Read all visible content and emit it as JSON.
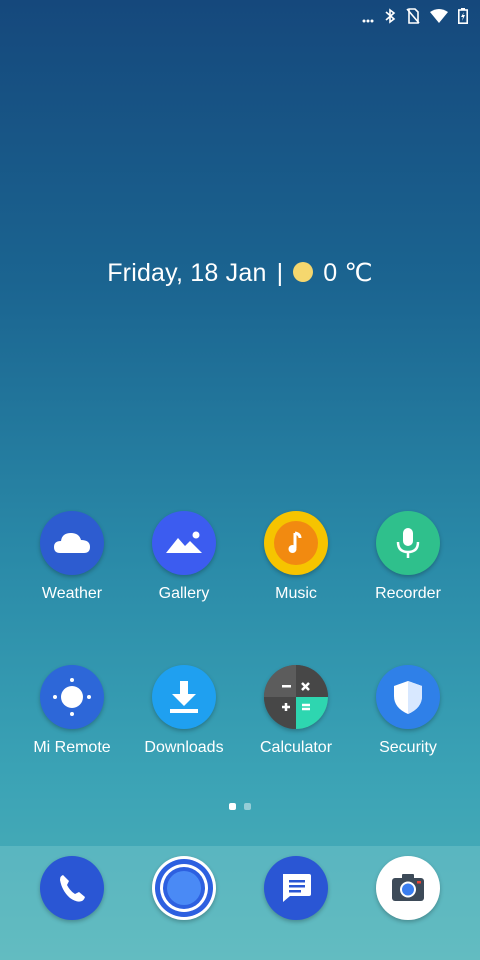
{
  "status_bar": {
    "icons": [
      "more-dots-icon",
      "bluetooth-icon",
      "no-sim-icon",
      "wifi-icon",
      "battery-charging-icon"
    ]
  },
  "widget": {
    "date": "Friday, 18 Jan",
    "separator": "|",
    "weather_icon": "sun-icon",
    "temperature": "0 ℃"
  },
  "home_apps": [
    {
      "label": "Weather",
      "icon": "cloud-icon",
      "color": "#2d5cd0"
    },
    {
      "label": "Gallery",
      "icon": "mountain-image-icon",
      "color": "#3c5cf0"
    },
    {
      "label": "Music",
      "icon": "music-note-icon",
      "color": "#f6c400"
    },
    {
      "label": "Recorder",
      "icon": "microphone-icon",
      "color": "#2fc08c"
    },
    {
      "label": "Mi Remote",
      "icon": "remote-icon",
      "color": "#2d67d8"
    },
    {
      "label": "Downloads",
      "icon": "download-icon",
      "color": "#1fa0f0"
    },
    {
      "label": "Calculator",
      "icon": "calculator-icon",
      "color": "#555555"
    },
    {
      "label": "Security",
      "icon": "shield-icon",
      "color": "#2f80e8"
    }
  ],
  "pager": {
    "pages": 2,
    "active": 1
  },
  "dock": [
    {
      "icon": "phone-icon",
      "color": "#2a56d4"
    },
    {
      "icon": "browser-icon",
      "color": "#2d60e0"
    },
    {
      "icon": "messaging-icon",
      "color": "#2a56d4"
    },
    {
      "icon": "camera-icon",
      "color": "#ffffff"
    }
  ]
}
